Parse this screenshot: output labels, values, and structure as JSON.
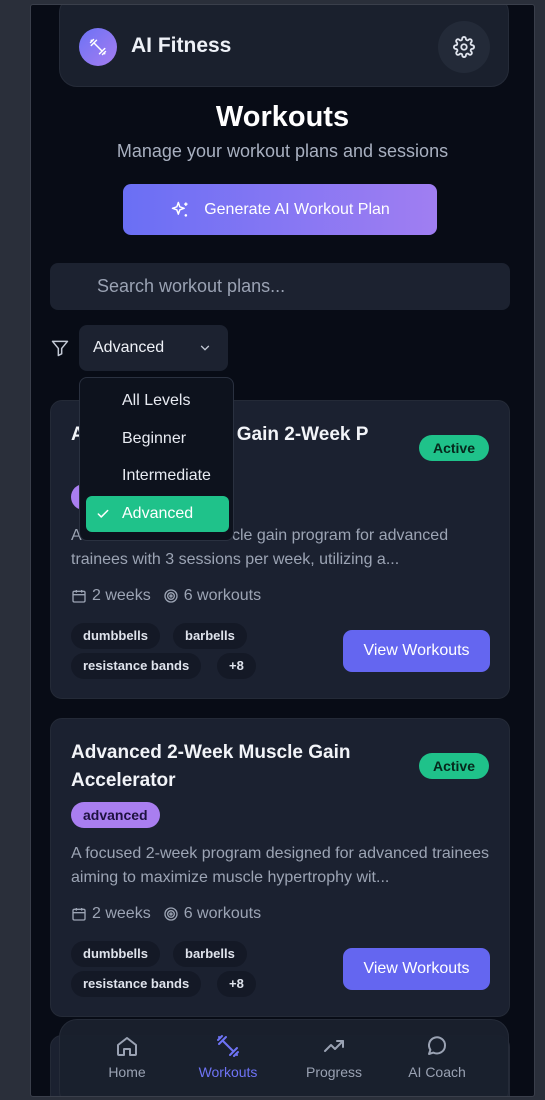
{
  "app": {
    "title": "AI Fitness"
  },
  "page": {
    "title": "Workouts",
    "subtitle": "Manage your workout plans and sessions"
  },
  "generate_button": {
    "label": "Generate AI Workout Plan"
  },
  "search": {
    "placeholder": "Search workout plans..."
  },
  "filter": {
    "selected": "Advanced",
    "options": [
      "All Levels",
      "Beginner",
      "Intermediate",
      "Advanced"
    ]
  },
  "cards": [
    {
      "title": "Advanced Muscle Gain 2-Week P",
      "status": "Active",
      "level": "advanced",
      "description": "A focused 2-week muscle gain program for advanced trainees with 3 sessions per week, utilizing a...",
      "duration": "2 weeks",
      "workouts": "6 workouts",
      "tags": [
        "dumbbells",
        "barbells",
        "resistance bands",
        "+8"
      ],
      "button": "View Workouts"
    },
    {
      "title": "Advanced 2-Week Muscle Gain Accelerator",
      "status": "Active",
      "level": "advanced",
      "description": "A focused 2-week program designed for advanced trainees aiming to maximize muscle hypertrophy wit...",
      "duration": "2 weeks",
      "workouts": "6 workouts",
      "tags": [
        "dumbbells",
        "barbells",
        "resistance bands",
        "+8"
      ],
      "button": "View Workouts"
    }
  ],
  "nav": [
    {
      "label": "Home",
      "icon": "home-icon"
    },
    {
      "label": "Workouts",
      "icon": "dumbbell-icon",
      "active": true
    },
    {
      "label": "Progress",
      "icon": "trending-up-icon"
    },
    {
      "label": "AI Coach",
      "icon": "chat-bubble-icon"
    }
  ],
  "colors": {
    "accent": "#6466f0",
    "active_badge": "#1fc28a",
    "level_badge": "#a97ef0",
    "background": "#080c16"
  }
}
